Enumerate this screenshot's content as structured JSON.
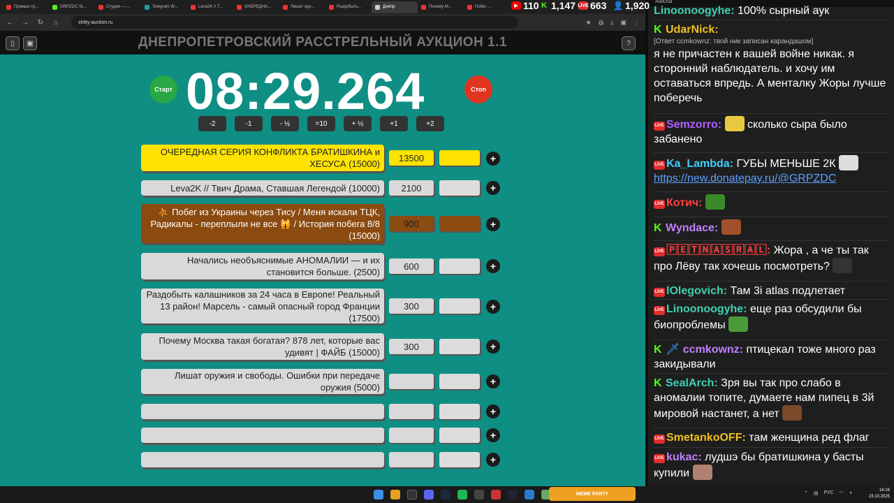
{
  "browser": {
    "tabs": [
      "Прямые тр...",
      "GRPZDC St...",
      "Студия — ...",
      "Telegram W...",
      "Leva2K // T...",
      "ОЧЕРЕДНА...",
      "Лишат ору...",
      "Раздобыть...",
      "Днёпр",
      "Почему М...",
      "Побег ..."
    ],
    "url": "shitty-auction.ru"
  },
  "stats": {
    "youtube": "110",
    "kick": "1,147",
    "live": "663",
    "viewers": "1,920"
  },
  "auction": {
    "title": "ДНЕПРОПЕТРОВСКИЙ РАССТРЕЛЬНЫЙ АУКЦИОН 1.1",
    "timer": "08:29.264",
    "start_label": "Старт",
    "stop_label": "Стоп",
    "adjust": [
      "-2",
      "-1",
      "- ½",
      "=10",
      "+ ½",
      "+1",
      "+2"
    ],
    "lots": [
      {
        "name": "ОЧЕРЕДНАЯ СЕРИЯ КОНФЛИКТА БРАТИШКИНА и ХЕСУСА (15000)",
        "amount": "13500"
      },
      {
        "name": "Leva2K // Твич Драма, Ставшая Легендой (10000)",
        "amount": "2100"
      },
      {
        "name": "⛹ Побег из Украины через Тису / Меня искали ТЦК, Радикалы - переплыли не все 🙀 / История побега 8/8 (15000)",
        "amount": "900"
      },
      {
        "name": "Начались необъяснимые АНОМАЛИИ — и их становится больше. (2500)",
        "amount": "600"
      },
      {
        "name": "Раздобыть калашников за 24 часа в Европе! Реальный 13 район! Марсель - самый опасный город Франции (17500)",
        "amount": "300"
      },
      {
        "name": "Почему Москва такая богатая? 878 лет, которые вас удивят | ФАЙБ (15000)",
        "amount": "300"
      },
      {
        "name": "Лишат оружия и свободы. Ошибки при передаче оружия (5000)",
        "amount": ""
      },
      {
        "name": "",
        "amount": ""
      },
      {
        "name": "",
        "amount": ""
      },
      {
        "name": "",
        "amount": ""
      }
    ],
    "plus_label": "+"
  },
  "chat": {
    "app_title": "AxelChat",
    "messages": [
      {
        "nick": "Linoonoogyhe:",
        "text": "100% сырный аук"
      },
      {
        "nick": "UdarNick:",
        "reply": "[Ответ ccmkownz: твой ник записан карандашом]",
        "text": "я не причастен к вашей войне никак. я сторонний наблюдатель. и хочу им оставаться впредь. А менталку Жоры лучше поберечь"
      },
      {
        "nick": "Semzorro:",
        "text": "сколько сыра было забанено"
      },
      {
        "nick": "Ka_Lambda:",
        "text": "ГУБЫ МЕНЬШЕ 2К",
        "link": "https://new.donatepay.ru/@GRPZDC"
      },
      {
        "nick": "Котич:",
        "text": ""
      },
      {
        "nick": "Wyndace:",
        "text": ""
      },
      {
        "nick": "🄿🄴🅃🄽🄰🅂🅁🄰🄻:",
        "text": "Жора , а че ты так про Лёву так хочешь посмотреть?"
      },
      {
        "nick": "lOlegovich:",
        "text": "Там 3i atlas подлетает"
      },
      {
        "nick": "Linoonoogyhe:",
        "text": "еще раз обсудили бы биопроблемы"
      },
      {
        "nick": "ccmkownz:",
        "text": "птицекал тоже много раз закидывали"
      },
      {
        "nick": "SealArch:",
        "text": "Зря вы так про слабо в аномалии топите, думаете нам пипец в 3й мировой настанет, а нет"
      },
      {
        "nick": "SmetankoOFF:",
        "text": "там женщина ред флаг"
      },
      {
        "nick": "kukac:",
        "text": "лудшэ бы братишкина у басты купили"
      }
    ]
  },
  "taskbar": {
    "lang": "РУС",
    "time": "16:16",
    "date": "23.10.2025",
    "widget": "MEME PARTY"
  },
  "colors": {
    "bg": "#0f8e83",
    "lot1": "#ffe300",
    "lot3": "#8a4a10",
    "start": "#27a844",
    "stop": "#e0341e"
  }
}
